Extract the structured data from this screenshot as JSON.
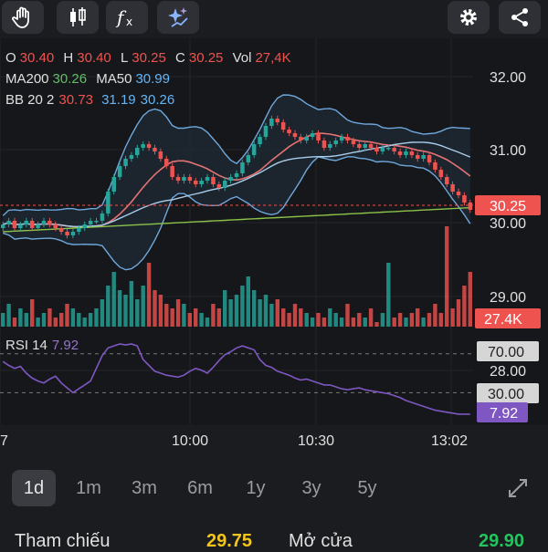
{
  "toolbar": {
    "buttons": [
      {
        "name": "drawing-tools-hand-icon"
      },
      {
        "name": "candlestick-chart-type-icon"
      },
      {
        "name": "indicator-fx-icon"
      },
      {
        "name": "ai-sparkle-icon"
      },
      {
        "name": "settings-gear-icon"
      },
      {
        "name": "share-icon"
      }
    ]
  },
  "legend": {
    "ohlc": {
      "o_label": "O",
      "o": "30.40",
      "h_label": "H",
      "h": "30.40",
      "l_label": "L",
      "l": "30.25",
      "c_label": "C",
      "c": "30.25",
      "vol_label": "Vol",
      "vol": "27,4K"
    },
    "ma": {
      "ma200_label": "MA200",
      "ma200": "30.26",
      "ma50_label": "MA50",
      "ma50": "30.99"
    },
    "bb": {
      "label": "BB 20 2",
      "upper": "30.73",
      "middle": "31.19",
      "lower": "30.26"
    },
    "rsi": {
      "label": "RSI 14",
      "value": "7.92"
    }
  },
  "price_axis": {
    "ticks": [
      "32.00",
      "31.00",
      "30.00",
      "29.00",
      "28.00"
    ],
    "last_price": "30.25",
    "volume_badge": "27.4K",
    "rsi_upper": "70.00",
    "rsi_lower": "30.00",
    "rsi_value": "7.92"
  },
  "time_axis": {
    "labels": [
      "7",
      "10:00",
      "10:30",
      "13:02"
    ]
  },
  "periods": {
    "items": [
      "1d",
      "1m",
      "3m",
      "6m",
      "1y",
      "3y",
      "5y"
    ],
    "active": "1d"
  },
  "stats": {
    "ref_label": "Tham chiếu",
    "ref_value": "29.75",
    "open_label": "Mở cửa",
    "open_value": "29.90"
  },
  "colors": {
    "up": "#26a69a",
    "down": "#ef5350",
    "ma200": "#8bc34a",
    "bb_band": "#6fa8dc",
    "bb_basis": "#e57373",
    "rsi": "#7e57c2",
    "rsi_value_badge": "#7e57c2",
    "label_red": "#ef5350",
    "label_green": "#66bb6a",
    "label_blue": "#64b5f6",
    "label_white": "#e0e0e0",
    "ref_value": "#f5c518",
    "open_value": "#22c55e"
  },
  "chart_data": {
    "type": "candlestick",
    "closes": [
      30.05,
      30.1,
      30.0,
      30.05,
      30.1,
      30.0,
      30.05,
      30.1,
      30.05,
      30.0,
      29.95,
      29.9,
      29.95,
      30.0,
      30.05,
      30.1,
      30.1,
      30.2,
      30.5,
      30.7,
      30.85,
      30.95,
      31.0,
      31.1,
      31.15,
      31.1,
      31.05,
      30.95,
      30.85,
      30.7,
      30.65,
      30.7,
      30.65,
      30.6,
      30.65,
      30.7,
      30.6,
      30.55,
      30.65,
      30.7,
      30.75,
      30.9,
      31.0,
      31.15,
      31.25,
      31.4,
      31.5,
      31.45,
      31.35,
      31.3,
      31.25,
      31.2,
      31.25,
      31.3,
      31.2,
      31.1,
      31.15,
      31.2,
      31.25,
      31.2,
      31.15,
      31.1,
      31.15,
      31.1,
      31.05,
      31.1,
      31.1,
      31.05,
      31.0,
      31.05,
      31.0,
      30.95,
      31.0,
      30.9,
      30.8,
      30.7,
      30.6,
      30.5,
      30.45,
      30.35,
      30.25
    ],
    "volumes": [
      3,
      5,
      2,
      4,
      3,
      6,
      2,
      3,
      4,
      2,
      3,
      5,
      4,
      3,
      2,
      3,
      4,
      6,
      9,
      12,
      8,
      7,
      10,
      6,
      9,
      14,
      8,
      7,
      5,
      4,
      6,
      5,
      3,
      4,
      3,
      2,
      5,
      4,
      8,
      6,
      7,
      9,
      11,
      8,
      6,
      7,
      5,
      6,
      4,
      3,
      5,
      4,
      3,
      2,
      3,
      2,
      4,
      3,
      2,
      5,
      2,
      3,
      2,
      4,
      1,
      3,
      14,
      2,
      3,
      2,
      3,
      4,
      2,
      3,
      5,
      3,
      22,
      4,
      6,
      9,
      12
    ],
    "rsi": [
      62,
      58,
      55,
      57,
      50,
      45,
      42,
      40,
      44,
      47,
      40,
      35,
      30,
      34,
      38,
      42,
      55,
      68,
      76,
      78,
      80,
      79,
      80,
      78,
      64,
      58,
      52,
      50,
      48,
      47,
      46,
      48,
      52,
      55,
      53,
      50,
      56,
      63,
      69,
      72,
      76,
      78,
      76,
      74,
      64,
      58,
      56,
      52,
      50,
      48,
      45,
      43,
      44,
      42,
      40,
      38,
      38,
      36,
      34,
      33,
      34,
      35,
      33,
      32,
      31,
      30,
      29,
      27,
      25,
      22,
      20,
      18,
      16,
      14,
      12,
      11,
      10,
      9,
      8,
      8,
      7.92
    ],
    "ylim": [
      27.5,
      32.3
    ],
    "x_labels": [
      "7",
      "10:00",
      "10:30",
      "13:02"
    ]
  }
}
